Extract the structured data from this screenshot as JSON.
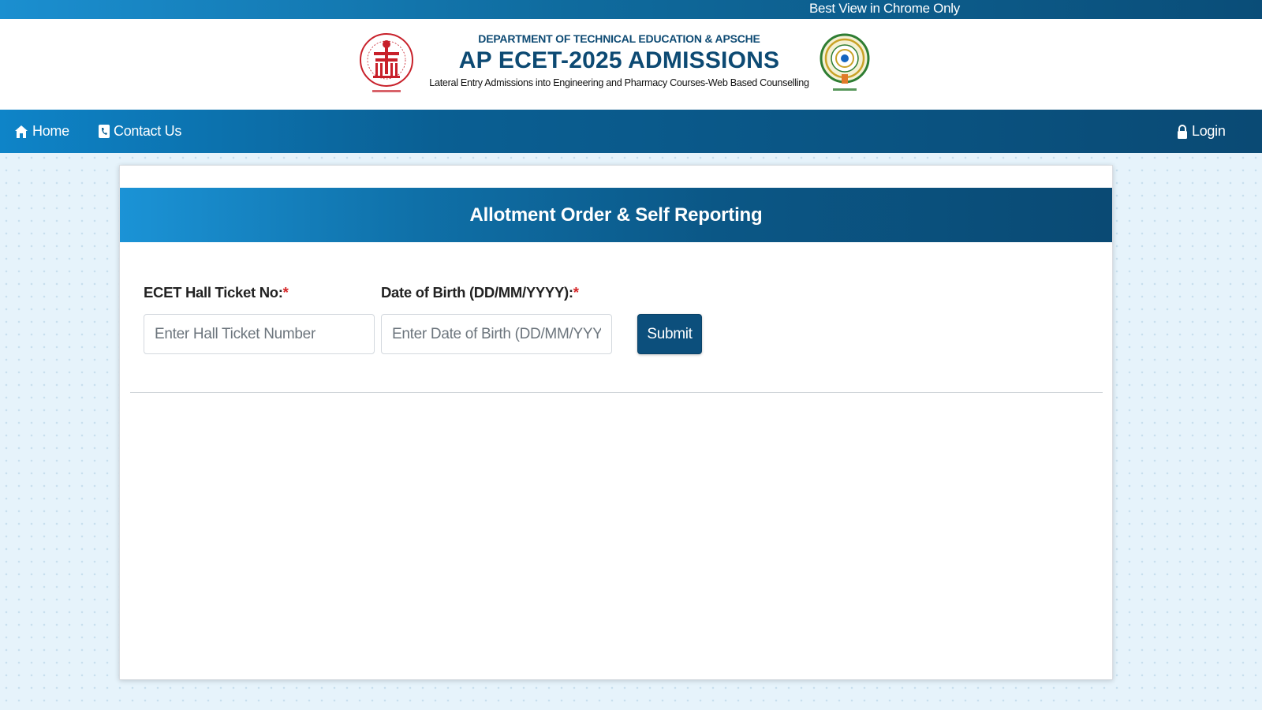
{
  "topbar": {
    "ticker": "Best View in Chrome Only"
  },
  "header": {
    "department": "DEPARTMENT OF TECHNICAL EDUCATION & APSCHE",
    "title": "AP ECET-2025 ADMISSIONS",
    "subtitle": "Lateral Entry Admissions into Engineering and Pharmacy Courses-Web Based Counselling",
    "logo_left": "apsche-emblem",
    "logo_right": "andhra-pradesh-state-emblem"
  },
  "nav": {
    "home": {
      "label": "Home",
      "icon": "home-icon"
    },
    "contact": {
      "label": "Contact Us",
      "icon": "phone-icon"
    },
    "login": {
      "label": "Login",
      "icon": "lock-icon"
    }
  },
  "form": {
    "title": "Allotment Order & Self Reporting",
    "hall_ticket": {
      "label": "ECET Hall Ticket No:",
      "required_mark": "*",
      "placeholder": "Enter Hall Ticket Number",
      "value": ""
    },
    "dob": {
      "label": "Date of Birth (DD/MM/YYYY):",
      "required_mark": "*",
      "placeholder": "Enter Date of Birth (DD/MM/YYYY)",
      "value": ""
    },
    "submit_label": "Submit"
  },
  "colors": {
    "primary": "#0c4f7c",
    "accent_light": "#1b93d6",
    "required": "#d62728",
    "emblem_red": "#c8202a"
  }
}
